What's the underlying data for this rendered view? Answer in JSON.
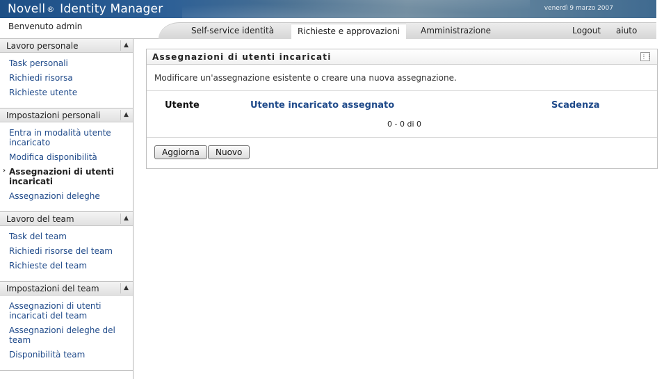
{
  "header": {
    "brand_name": "Novell",
    "brand_reg": "®",
    "brand_product": "Identity Manager",
    "date": "venerdì 9 marzo 2007"
  },
  "navbar": {
    "welcome": "Benvenuto admin",
    "tabs": [
      {
        "label": "Self-service identità",
        "active": false
      },
      {
        "label": "Richieste e approvazioni",
        "active": true
      },
      {
        "label": "Amministrazione",
        "active": false
      }
    ],
    "logout": "Logout",
    "help": "aiuto"
  },
  "sidebar": {
    "sections": [
      {
        "title": "Lavoro personale",
        "items": [
          "Task personali",
          "Richiedi risorsa",
          "Richieste utente"
        ]
      },
      {
        "title": "Impostazioni personali",
        "items": [
          "Entra in modalità utente incaricato",
          "Modifica disponibilità",
          "Assegnazioni di utenti incaricati",
          "Assegnazioni deleghe"
        ],
        "current_index": 2
      },
      {
        "title": "Lavoro del team",
        "items": [
          "Task del team",
          "Richiedi risorse del team",
          "Richieste del team"
        ]
      },
      {
        "title": "Impostazioni del team",
        "items": [
          "Assegnazioni di utenti incaricati del team",
          "Assegnazioni deleghe del team",
          "Disponibilità team"
        ]
      }
    ]
  },
  "panel": {
    "title": "Assegnazioni di utenti incaricati",
    "description": "Modificare un'assegnazione esistente o creare una nuova assegnazione.",
    "columns": [
      "Utente",
      "Utente incaricato assegnato",
      "Scadenza"
    ],
    "count": "0 - 0 di 0",
    "buttons": {
      "refresh": "Aggiorna",
      "new": "Nuovo"
    }
  },
  "colors": {
    "link": "#1f4a8a",
    "header_blue": "#1d4f86"
  }
}
